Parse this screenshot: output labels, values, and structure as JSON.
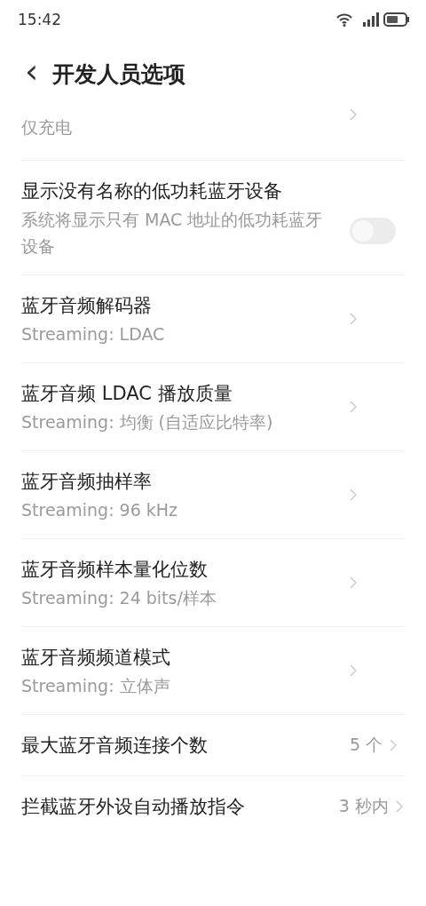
{
  "status_bar": {
    "time": "15:42"
  },
  "header": {
    "back": "‹",
    "title": "开发人员选项"
  },
  "settings": [
    {
      "kind": "link",
      "subtitle": "仅充电"
    },
    {
      "kind": "toggle",
      "title": "显示没有名称的低功耗蓝牙设备",
      "subtitle": "系统将显示只有 MAC 地址的低功耗蓝牙设备",
      "on": false,
      "disabled": true
    },
    {
      "kind": "link",
      "title": "蓝牙音频解码器",
      "subtitle": "Streaming: LDAC"
    },
    {
      "kind": "link",
      "title": "蓝牙音频 LDAC 播放质量",
      "subtitle": "Streaming: 均衡 (自适应比特率)"
    },
    {
      "kind": "link",
      "title": "蓝牙音频抽样率",
      "subtitle": "Streaming: 96 kHz"
    },
    {
      "kind": "link",
      "title": "蓝牙音频样本量化位数",
      "subtitle": "Streaming: 24 bits/样本"
    },
    {
      "kind": "link",
      "title": "蓝牙音频频道模式",
      "subtitle": "Streaming: 立体声"
    },
    {
      "kind": "value",
      "title": "最大蓝牙音频连接个数",
      "value": "5 个"
    },
    {
      "kind": "value",
      "title": "拦截蓝牙外设自动播放指令",
      "value": "3 秒内"
    }
  ]
}
